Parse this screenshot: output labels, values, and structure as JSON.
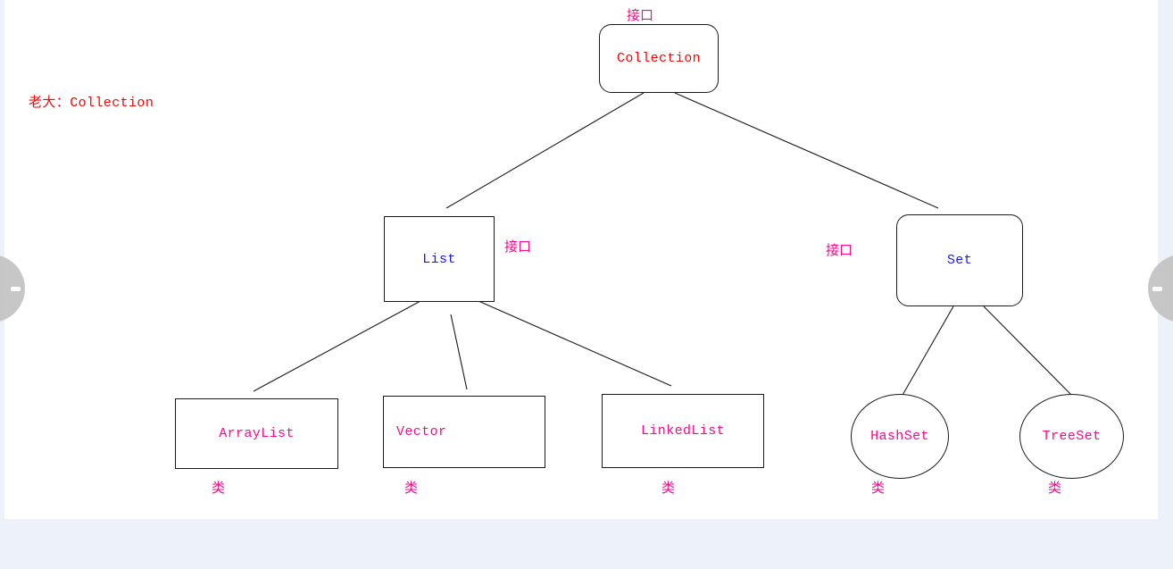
{
  "page": {
    "background": "#edf1fa",
    "canvas_background": "#ffffff",
    "colors": {
      "red": "#fa0505",
      "blue": "#1a1ae8",
      "pink": "#fa0a8c",
      "stroke": "#1a1a1a"
    }
  },
  "corner_note": "老大：Collection",
  "nodes": {
    "collection": {
      "label": "Collection",
      "tag": "接口"
    },
    "list": {
      "label": "List",
      "tag": "接口"
    },
    "set": {
      "label": "Set",
      "tag": "接口"
    },
    "arraylist": {
      "label": "ArrayList",
      "tag": "类"
    },
    "vector": {
      "label": "Vector",
      "tag": "类"
    },
    "linkedlist": {
      "label": "LinkedList",
      "tag": "类"
    },
    "hashset": {
      "label": "HashSet",
      "tag": "类"
    },
    "treeset": {
      "label": "TreeSet",
      "tag": "类"
    }
  },
  "nav": {
    "prev": "prev-slide",
    "next": "next-slide"
  }
}
